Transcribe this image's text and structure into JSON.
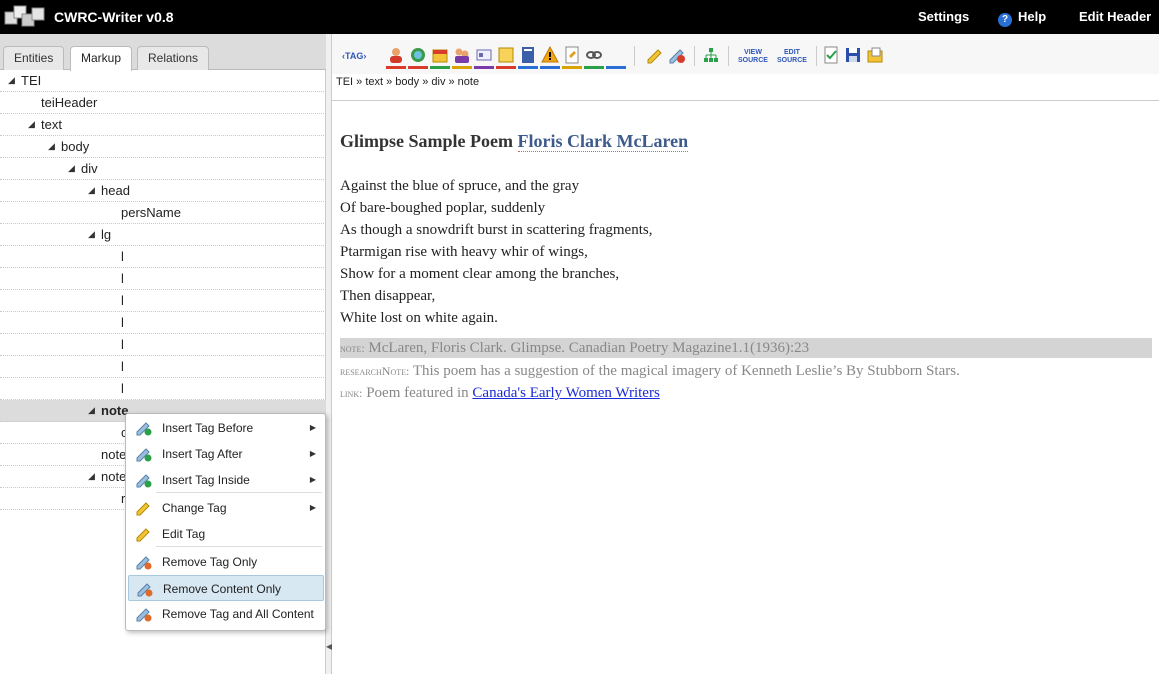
{
  "app": {
    "title": "CWRC-Writer v0.8",
    "nav": {
      "settings": "Settings",
      "help": "Help",
      "edit_header": "Edit Header"
    }
  },
  "left_panel": {
    "tabs": [
      "Entities",
      "Markup",
      "Relations"
    ],
    "active_tab": "Markup",
    "tree": [
      {
        "label": "TEI",
        "depth": 0,
        "expanded": true
      },
      {
        "label": "teiHeader",
        "depth": 1,
        "expanded": null
      },
      {
        "label": "text",
        "depth": 1,
        "expanded": true
      },
      {
        "label": "body",
        "depth": 2,
        "expanded": true
      },
      {
        "label": "div",
        "depth": 3,
        "expanded": true
      },
      {
        "label": "head",
        "depth": 4,
        "expanded": true
      },
      {
        "label": "persName",
        "depth": 5,
        "expanded": null
      },
      {
        "label": "lg",
        "depth": 4,
        "expanded": true
      },
      {
        "label": "l",
        "depth": 5,
        "expanded": null
      },
      {
        "label": "l",
        "depth": 5,
        "expanded": null
      },
      {
        "label": "l",
        "depth": 5,
        "expanded": null
      },
      {
        "label": "l",
        "depth": 5,
        "expanded": null
      },
      {
        "label": "l",
        "depth": 5,
        "expanded": null
      },
      {
        "label": "l",
        "depth": 5,
        "expanded": null
      },
      {
        "label": "l",
        "depth": 5,
        "expanded": null
      },
      {
        "label": "note",
        "depth": 4,
        "expanded": true,
        "selected": true
      },
      {
        "label": "c",
        "depth": 5,
        "expanded": null
      },
      {
        "label": "note",
        "depth": 4,
        "expanded": null
      },
      {
        "label": "note",
        "depth": 4,
        "expanded": true
      },
      {
        "label": "r",
        "depth": 5,
        "expanded": null
      }
    ]
  },
  "context_menu": {
    "items": [
      {
        "label": "Insert Tag Before",
        "icon": "tag-add-icon",
        "submenu": true
      },
      {
        "label": "Insert Tag After",
        "icon": "tag-add-icon",
        "submenu": true
      },
      {
        "label": "Insert Tag Inside",
        "icon": "tag-add-icon",
        "submenu": true
      },
      {
        "label": "Change Tag",
        "icon": "tag-edit-icon",
        "submenu": true
      },
      {
        "label": "Edit Tag",
        "icon": "tag-edit-icon",
        "submenu": false
      },
      {
        "label": "Remove Tag Only",
        "icon": "tag-remove-icon",
        "submenu": false
      },
      {
        "label": "Remove Content Only",
        "icon": "tag-remove-icon",
        "submenu": false,
        "hover": true
      },
      {
        "label": "Remove Tag and All Content",
        "icon": "tag-remove-icon",
        "submenu": false
      }
    ]
  },
  "editor": {
    "toolbar": {
      "tag_button": "‹TAG›",
      "view_source": "VIEW SOURCE",
      "edit_source": "EDIT SOURCE",
      "underline_colors": [
        "#d93b2b",
        "#d93b2b",
        "#2aa04a",
        "#d9a400",
        "#7a3aa8",
        "#d93b2b",
        "#2a6fd6",
        "#2a6fd6",
        "#d9a400",
        "#2aa04a",
        "#2a6fd6"
      ]
    },
    "breadcrumb": "TEI » text » body » div » note",
    "document": {
      "title": "Glimpse Sample Poem",
      "author": "Floris Clark McLaren",
      "lines": [
        "Against the blue of spruce, and the gray",
        "Of bare-boughed poplar, suddenly",
        "As though a snowdrift burst in scattering fragments,",
        "Ptarmigan rise with heavy whir of wings,",
        "Show for a moment clear among the branches,",
        "Then disappear,",
        "White lost on white again."
      ],
      "note": {
        "label": "note:",
        "text": "McLaren, Floris Clark. Glimpse. Canadian Poetry Magazine1.1(1936):23"
      },
      "research_note": {
        "label": "researchNote:",
        "text": "This poem has a suggestion of the magical imagery of Kenneth Leslie’s By Stubborn Stars."
      },
      "link": {
        "label": "link:",
        "text": "Poem featured in",
        "anchor": "Canada's Early Women Writers"
      }
    }
  }
}
